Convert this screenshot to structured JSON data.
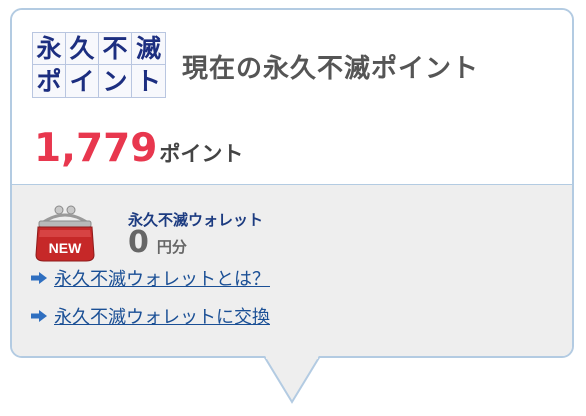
{
  "logo": {
    "chars": [
      "永",
      "久",
      "不",
      "滅",
      "ポ",
      "イ",
      "ン",
      "ト"
    ]
  },
  "header": {
    "title": "現在の永久不滅ポイント"
  },
  "points": {
    "value": "1,779",
    "unit": "ポイント"
  },
  "wallet": {
    "badge": "NEW",
    "name": "永久不滅ウォレット",
    "value": "0",
    "unit": "円分"
  },
  "links": [
    {
      "label": "永久不滅ウォレットとは？"
    },
    {
      "label": "永久不滅ウォレットに交換"
    }
  ],
  "colors": {
    "accent_red": "#e8374e",
    "link_blue": "#1a4f95",
    "border": "#b3cbe2"
  }
}
